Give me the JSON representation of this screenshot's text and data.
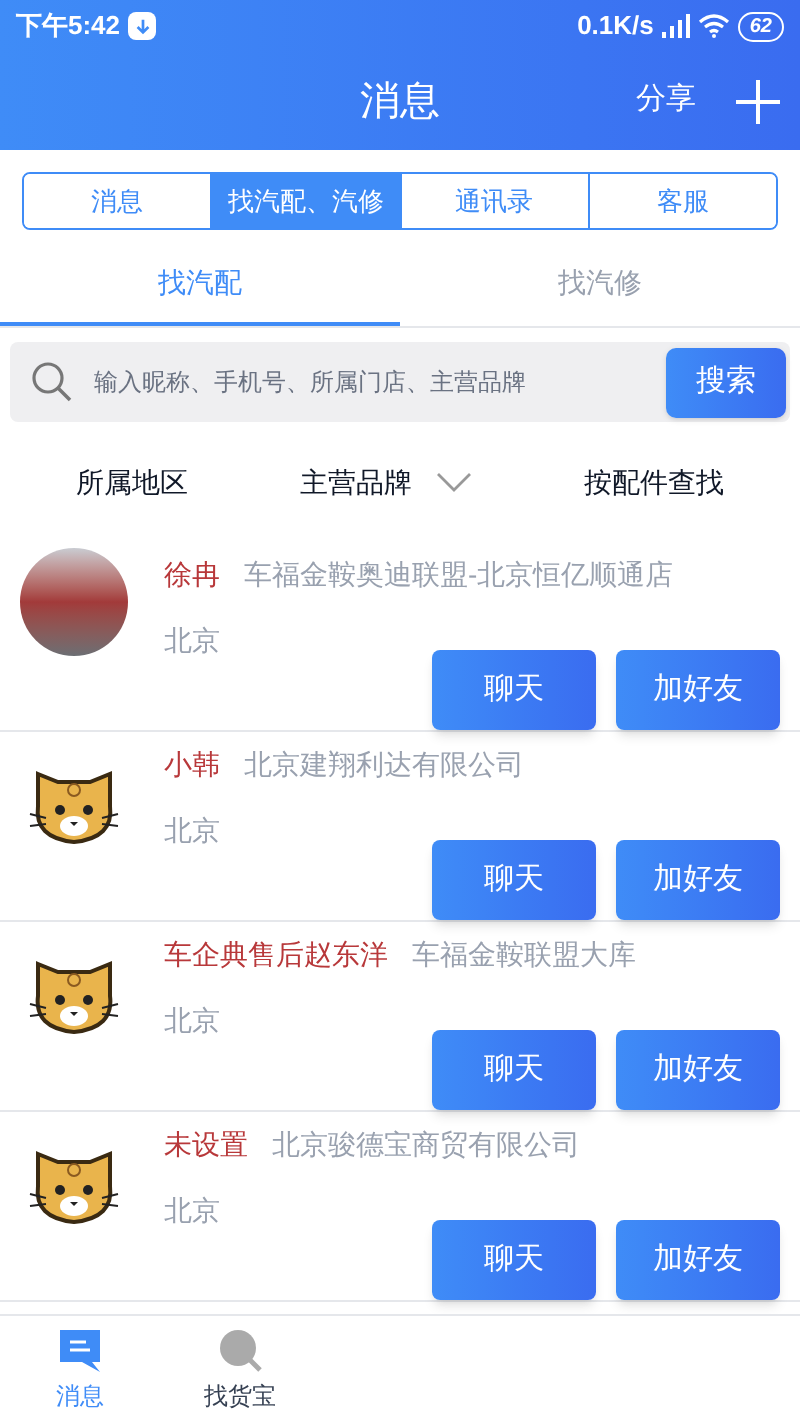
{
  "status_bar": {
    "time": "下午5:42",
    "speed": "0.1K/s",
    "battery": "62"
  },
  "header": {
    "title": "消息",
    "share": "分享"
  },
  "segments": [
    {
      "label": "消息",
      "selected": false
    },
    {
      "label": "找汽配、汽修",
      "selected": true
    },
    {
      "label": "通讯录",
      "selected": false
    },
    {
      "label": "客服",
      "selected": false
    }
  ],
  "sub_tabs": [
    {
      "label": "找汽配",
      "selected": true
    },
    {
      "label": "找汽修",
      "selected": false
    }
  ],
  "search": {
    "placeholder": "输入昵称、手机号、所属门店、主营品牌",
    "button": "搜索"
  },
  "filters": [
    {
      "label": "所属地区",
      "dropdown": false
    },
    {
      "label": "主营品牌",
      "dropdown": true
    },
    {
      "label": "按配件查找",
      "dropdown": false
    }
  ],
  "contacts": [
    {
      "kind": "photo",
      "name": "徐冉",
      "company": "车福金鞍奥迪联盟-北京恒亿顺通店",
      "city": "北京",
      "buttons": [
        "聊天",
        "加好友"
      ]
    },
    {
      "kind": "cat",
      "name": "小韩",
      "company": "北京建翔利达有限公司",
      "city": "北京",
      "buttons": [
        "聊天",
        "加好友"
      ]
    },
    {
      "kind": "cat",
      "name": "车企典售后赵东洋",
      "company": "车福金鞍联盟大库",
      "city": "北京",
      "buttons": [
        "聊天",
        "加好友"
      ]
    },
    {
      "kind": "cat",
      "name": "未设置",
      "company": "北京骏德宝商贸有限公司",
      "city": "北京",
      "buttons": [
        "聊天",
        "加好友"
      ]
    }
  ],
  "bottom_nav": [
    {
      "label": "消息",
      "kind": "chat",
      "selected": true
    },
    {
      "label": "找货宝",
      "kind": "search",
      "selected": false
    }
  ]
}
